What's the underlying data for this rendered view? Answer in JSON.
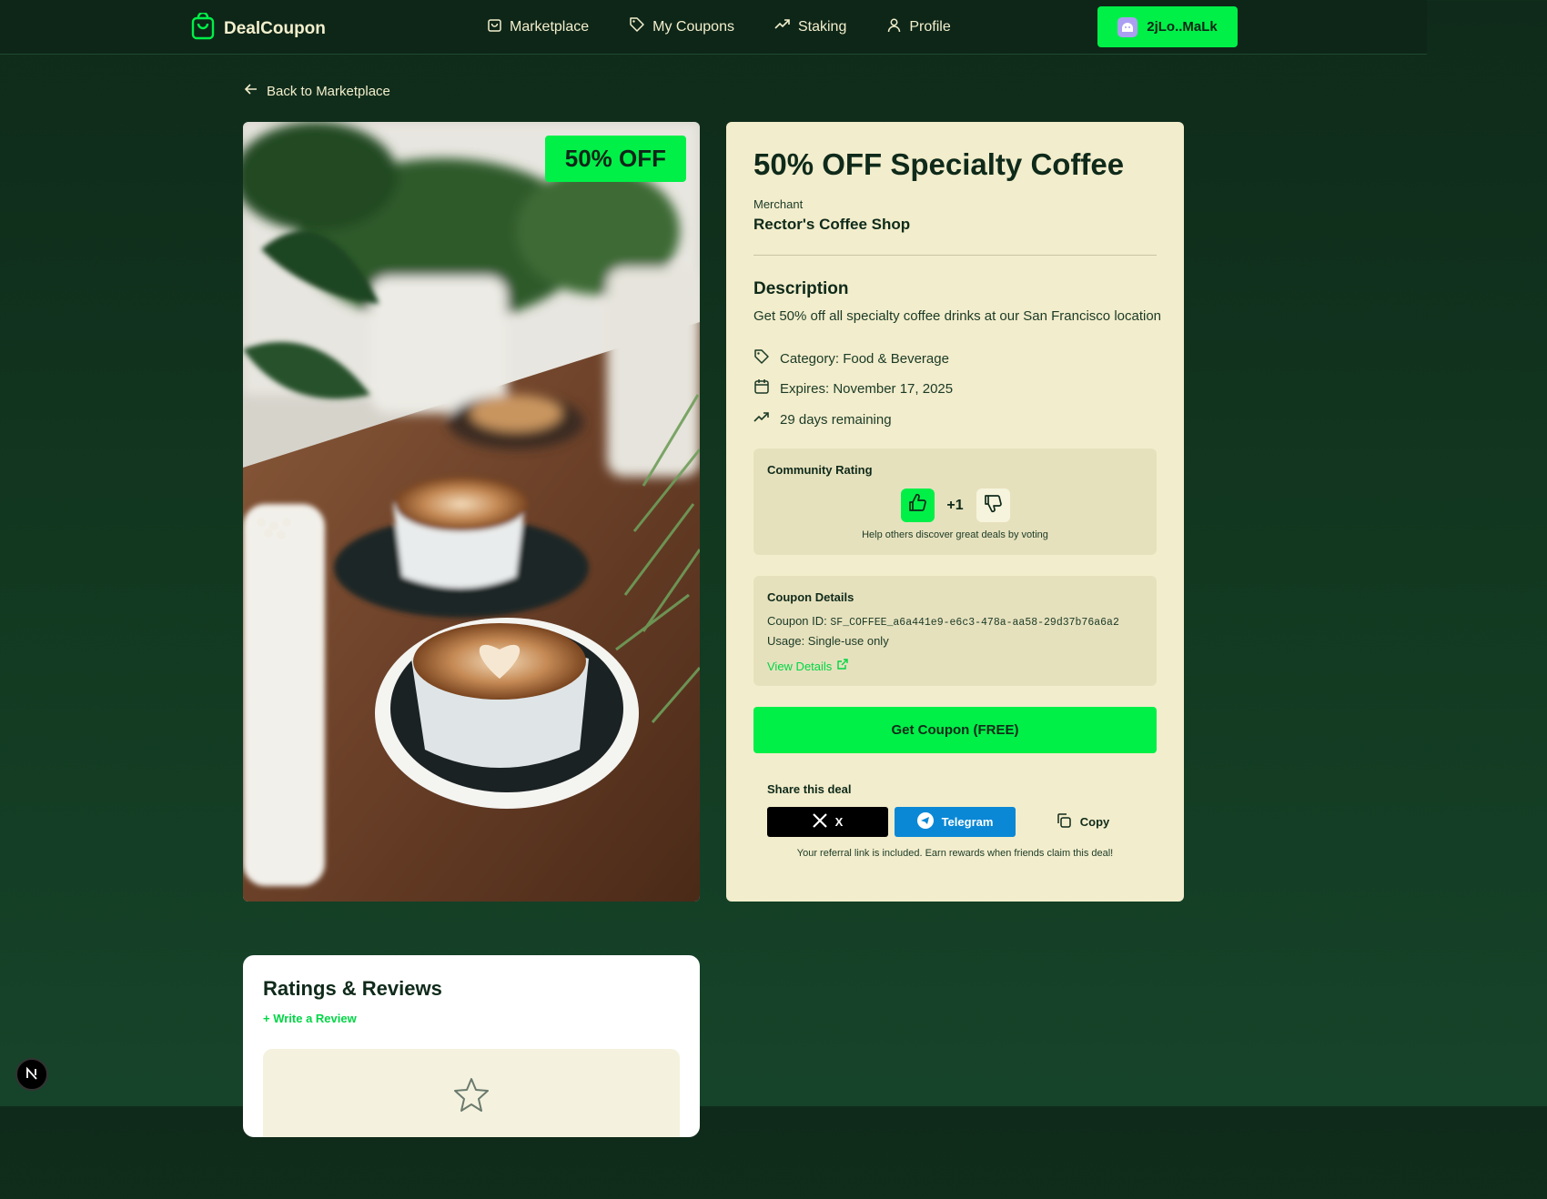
{
  "nav": {
    "brand": "DealCoupon",
    "links": [
      {
        "label": "Marketplace",
        "icon": "bag-icon"
      },
      {
        "label": "My Coupons",
        "icon": "tag-icon"
      },
      {
        "label": "Staking",
        "icon": "trending-up-icon"
      },
      {
        "label": "Profile",
        "icon": "user-icon"
      }
    ],
    "wallet": "2jLo..MaLk"
  },
  "back_label": "Back to Marketplace",
  "deal": {
    "badge": "50% OFF",
    "title": "50% OFF Specialty Coffee",
    "merchant_label": "Merchant",
    "merchant": "Rector's Coffee Shop",
    "description_heading": "Description",
    "description": "Get 50% off all specialty coffee drinks at our San Francisco location",
    "category": "Category: Food & Beverage",
    "expires": "Expires: November 17, 2025",
    "remaining": "29 days remaining"
  },
  "rating": {
    "heading": "Community Rating",
    "score": "+1",
    "help": "Help others discover great deals by voting"
  },
  "coupon_details": {
    "heading": "Coupon Details",
    "id_label": "Coupon ID:",
    "id_value": "SF_COFFEE_a6a441e9-e6c3-478a-aa58-29d37b76a6a2",
    "usage": "Usage: Single-use only",
    "view_details": "View Details"
  },
  "get_button": "Get Coupon (FREE)",
  "share": {
    "heading": "Share this deal",
    "x": "X",
    "telegram": "Telegram",
    "copy": "Copy",
    "referral": "Your referral link is included. Earn rewards when friends claim this deal!"
  },
  "reviews": {
    "heading": "Ratings & Reviews",
    "write": "+ Write a Review"
  },
  "colors": {
    "accent": "#00f048",
    "background": "#123820",
    "card": "#f2edcc"
  }
}
